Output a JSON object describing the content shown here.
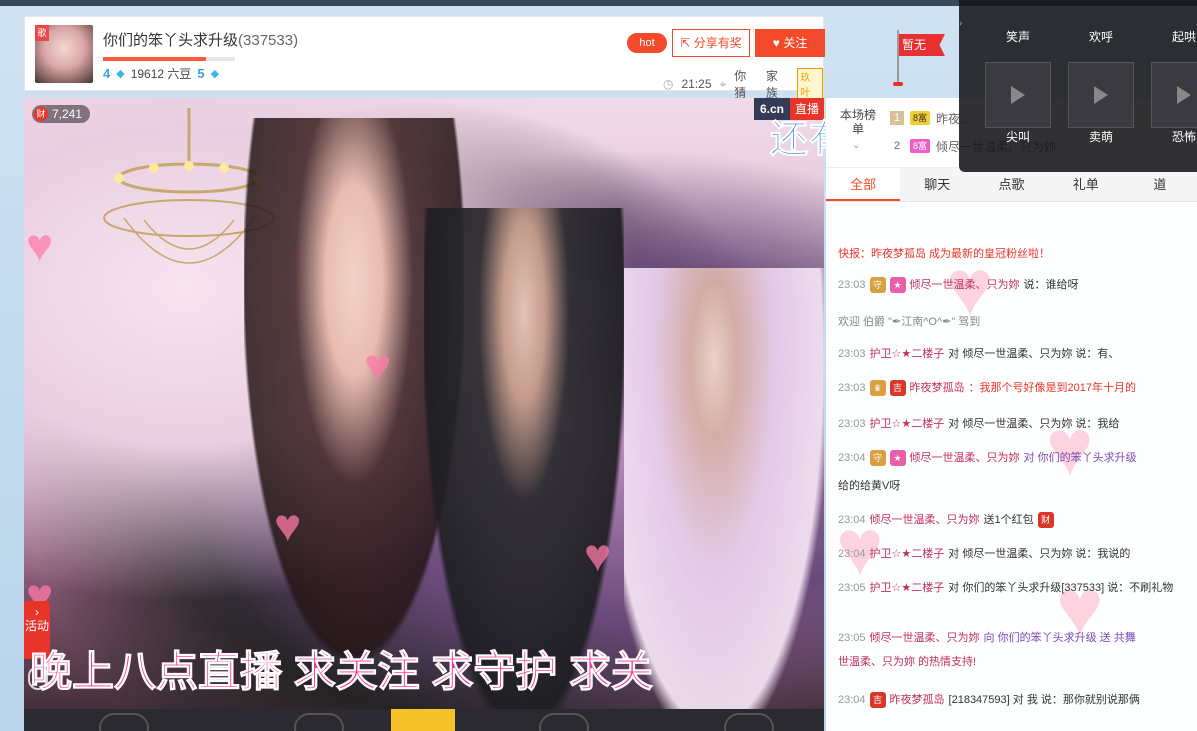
{
  "header": {
    "avatar_badge": "歌",
    "room_name": "你们的笨丫头求升级",
    "room_id": "(337533)",
    "level_fraction": 0.78,
    "wealth_level": "4",
    "beans": "19612 六豆",
    "star_level": "5",
    "hot_label": "hot",
    "share_label": "分享有奖",
    "follow_label": "关注",
    "time": "21:25",
    "location": "你猜",
    "family_label": "家族",
    "family_tag": "玖叶",
    "flag_label": "暂无"
  },
  "video": {
    "viewers": "7,241",
    "coin_icon": "财",
    "logo_brand": "6.cn",
    "logo_live": "直播",
    "activity_label": "活动",
    "lyric": "还有谁能够留住",
    "marquee": "晚上八点直播  求关注  求守护  求关"
  },
  "rank": {
    "title": "本场榜单",
    "rows": [
      {
        "num": "1",
        "tag": "8富",
        "name": "昨夜..."
      },
      {
        "num": "2",
        "tag": "8富",
        "name": "倾尽一世温柔、只为妳"
      }
    ]
  },
  "tabs": [
    {
      "label": "全部"
    },
    {
      "label": "聊天"
    },
    {
      "label": "点歌"
    },
    {
      "label": "礼单"
    },
    {
      "label": "道"
    }
  ],
  "chat": {
    "broadcast": "快报：昨夜梦孤岛 成为最新的皇冠粉丝啦！",
    "lines": [
      {
        "time": "23:03",
        "name": "倾尽一世温柔、只为妳",
        "text": "说：谁给呀"
      },
      {
        "time": "",
        "name": "",
        "text": "欢迎 伯爵 \"✒江南^O^✒\" 驾到"
      },
      {
        "time": "23:03",
        "name": "护卫☆★二楼子",
        "text": "对 倾尽一世温柔、只为妳 说：有、"
      },
      {
        "time": "23:03",
        "name": "昨夜梦孤岛",
        "text": "：我那个号好像是到2017年十月的"
      },
      {
        "time": "23:03",
        "name": "护卫☆★二楼子",
        "text": "对 倾尽一世温柔、只为妳 说：我给"
      },
      {
        "time": "23:04",
        "name": "倾尽一世温柔、只为妳",
        "text": "对 你们的笨丫头求升级"
      },
      {
        "time": "",
        "name": "",
        "text": "给的给黄V呀"
      },
      {
        "time": "23:04",
        "name": "倾尽一世温柔、只为妳",
        "text": "送1个红包"
      },
      {
        "time": "23:04",
        "name": "护卫☆★二楼子",
        "text": "对 倾尽一世温柔、只为妳 说：我说的"
      },
      {
        "time": "23:05",
        "name": "护卫☆★二楼子",
        "text": "对 你们的笨丫头求升级[337533] 说：不刷礼物"
      },
      {
        "time": "23:05",
        "name": "倾尽一世温柔、只为妳",
        "text": "向 你们的笨丫头求升级 送 共舞"
      },
      {
        "time": "",
        "name": "",
        "text": "世温柔、只为妳 的热情支持!"
      },
      {
        "time": "23:04",
        "name": "昨夜梦孤岛",
        "text": "[218347593] 对 我 说：那你就别说那俩"
      }
    ]
  },
  "effects": {
    "items": [
      {
        "label": "笑声"
      },
      {
        "label": "欢呼"
      },
      {
        "label": "起哄"
      },
      {
        "label": "尖叫"
      },
      {
        "label": "卖萌"
      },
      {
        "label": "恐怖"
      }
    ]
  }
}
